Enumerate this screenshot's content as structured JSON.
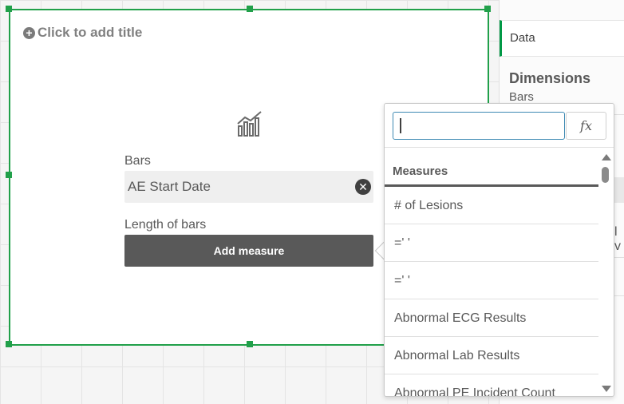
{
  "chart": {
    "title_placeholder": "Click to add title",
    "dimension_label": "Bars",
    "dimension_value": "AE Start Date",
    "measure_label": "Length of bars",
    "add_measure_label": "Add measure",
    "chart_type_icon": "bar-chart-icon"
  },
  "properties_panel": {
    "tab_label": "Data",
    "section_heading": "Dimensions",
    "section_subheading": "Bars",
    "cut_off_text": "l v"
  },
  "measure_picker": {
    "search_value": "",
    "fx_label": "fx",
    "list_heading": "Measures",
    "items": [
      "# of Lesions",
      "=' '",
      "=' '",
      "Abnormal ECG Results",
      "Abnormal Lab Results",
      "Abnormal PE Incident Count"
    ]
  },
  "colors": {
    "selection_green": "#21a04a",
    "tab_accent": "#009845",
    "button_dark": "#595959"
  }
}
